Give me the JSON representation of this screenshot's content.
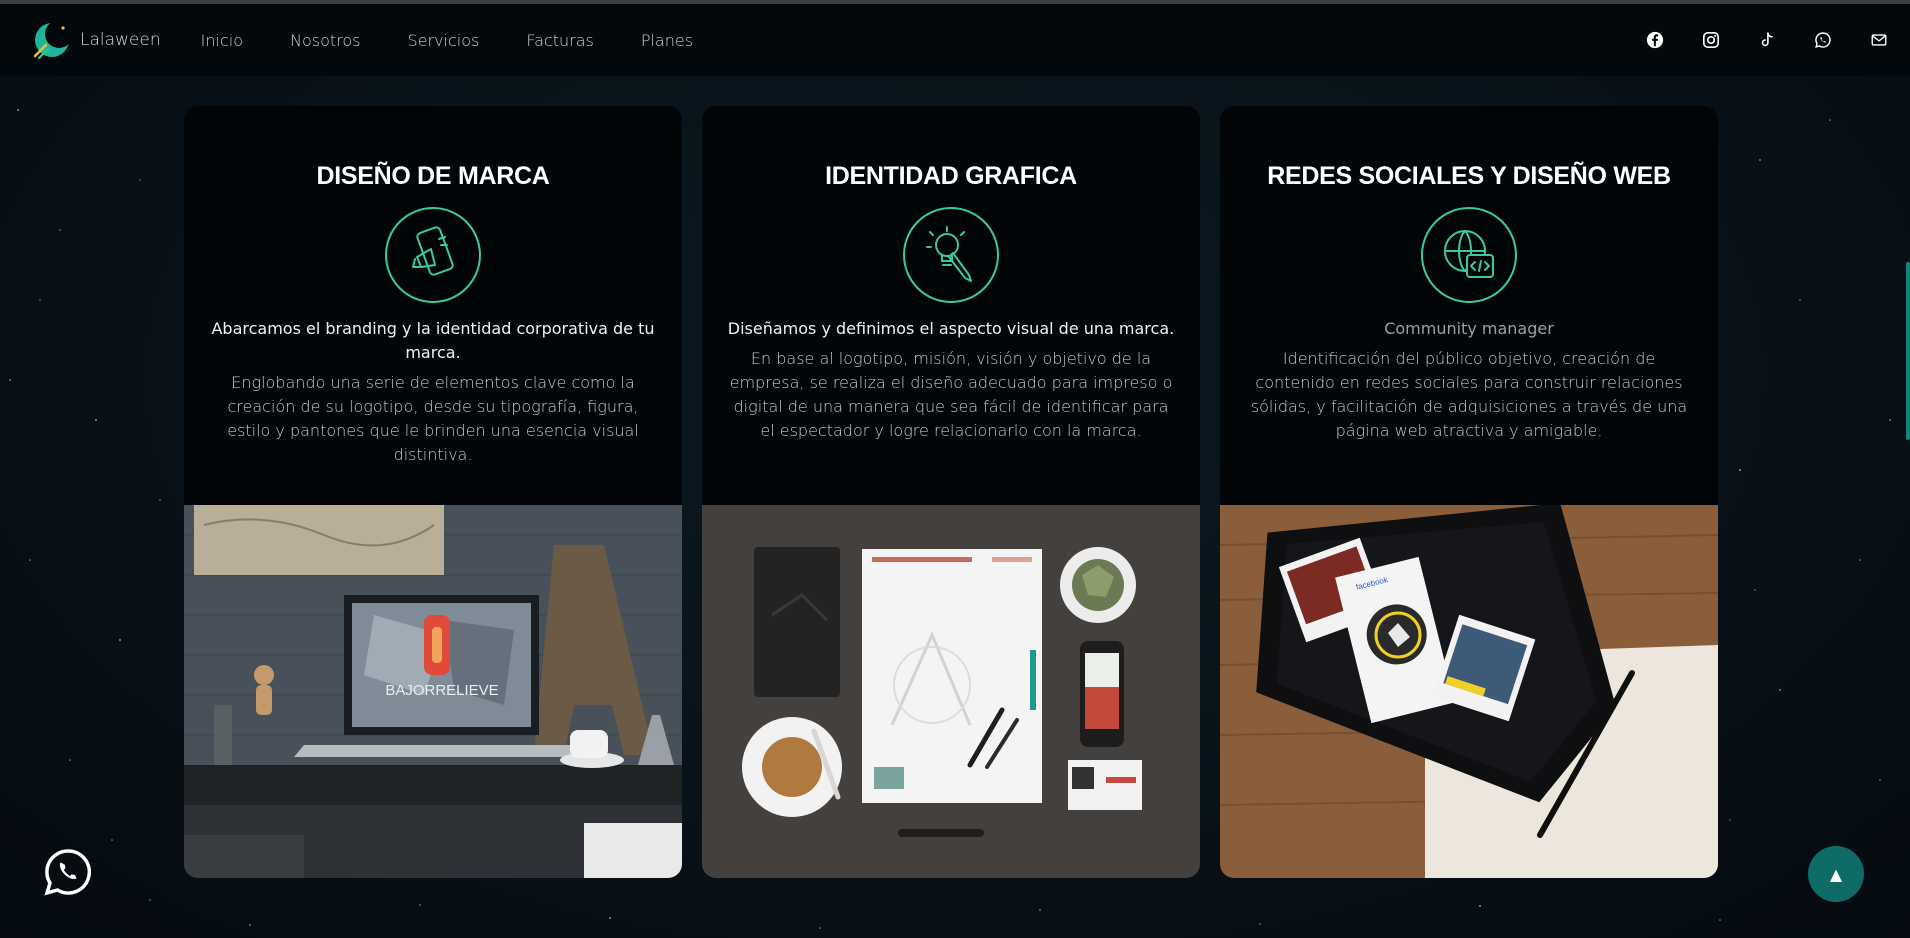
{
  "header": {
    "brand_name": "Lalaween",
    "logo_icon": "crescent-moon-logo",
    "nav": [
      {
        "label": "Inicio"
      },
      {
        "label": "Nosotros"
      },
      {
        "label": "Servicios"
      },
      {
        "label": "Facturas"
      },
      {
        "label": "Planes"
      }
    ],
    "social_icons": [
      "facebook-icon",
      "instagram-icon",
      "tiktok-icon",
      "whatsapp-icon",
      "mail-icon"
    ]
  },
  "cards": [
    {
      "title": "DISEÑO DE MARCA",
      "icon": "smartphone-megaphone-icon",
      "lead": "Abarcamos el branding y la identidad corporativa de tu marca.",
      "description": "Englobando una serie de elementos clave como la creación de su logotipo, desde su tipografía, figura, estilo y pantones que le brinden una esencia visual distintiva.",
      "image": "laptop-desk-mockup-photo",
      "image_text": "BAJORRELIEVE"
    },
    {
      "title": "IDENTIDAD GRAFICA",
      "icon": "lightbulb-pencil-icon",
      "lead": "Diseñamos y definimos el aspecto visual de una marca.",
      "description": "En base al logotipo, misión, visión y objetivo de la empresa, se realiza el diseño adecuado para impreso o digital de una manera que sea fácil de identificar para el espectador y logre relacionarlo con la marca.",
      "image": "stationery-mockup-photo"
    },
    {
      "title": "REDES SOCIALES Y DISEÑO WEB",
      "icon": "globe-code-icon",
      "lead": "Community manager",
      "description": "Identificación del público objetivo, creación de contenido en redes sociales para construir relaciones sólidas, y facilitación de adquisiciones a través de una página web atractiva y amigable.",
      "image": "tablet-social-media-photo",
      "image_text": "facebook"
    }
  ],
  "floating": {
    "whatsapp_icon": "whatsapp-chat-icon",
    "back_to_top_label": "▲"
  },
  "colors": {
    "accent": "#3ec8a0",
    "page_background": "#081219",
    "card_background": "#020507",
    "back_to_top": "#0f6b66"
  }
}
